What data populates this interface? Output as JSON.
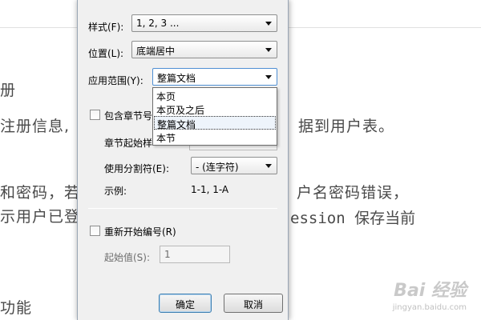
{
  "background_doc": {
    "lines": [
      {
        "text": "册"
      },
      {
        "text": "注册信息,"
      },
      {
        "text": "据到用户表。"
      },
      {
        "text": "和密码，若"
      },
      {
        "text": "户名密码错误，"
      },
      {
        "text": "示用户已登"
      },
      {
        "text": "ession 保存当前"
      },
      {
        "text": "功能"
      }
    ],
    "watermark": {
      "logo": "Bai 经验",
      "url": "jingyan.baidu.com"
    }
  },
  "dialog": {
    "format": {
      "label": "样式(F):",
      "value": "1, 2, 3 ..."
    },
    "position": {
      "label": "位置(L):",
      "value": "底端居中"
    },
    "scope": {
      "label": "应用范围(Y):",
      "value": "整篇文档",
      "options": [
        "本页",
        "本页及之后",
        "整篇文档",
        "本节"
      ]
    },
    "include_chapter": {
      "label": "包含章节号"
    },
    "chapter_start": {
      "label": "章节起始样"
    },
    "separator": {
      "label": "使用分割符(E):",
      "value": "-   (连字符)"
    },
    "example": {
      "label": "示例:",
      "value": "1-1, 1-A"
    },
    "restart": {
      "label": "重新开始编号(R)"
    },
    "start_value": {
      "label": "起始值(S):",
      "value": "1"
    },
    "ok_label": "确定",
    "cancel_label": "取消"
  }
}
